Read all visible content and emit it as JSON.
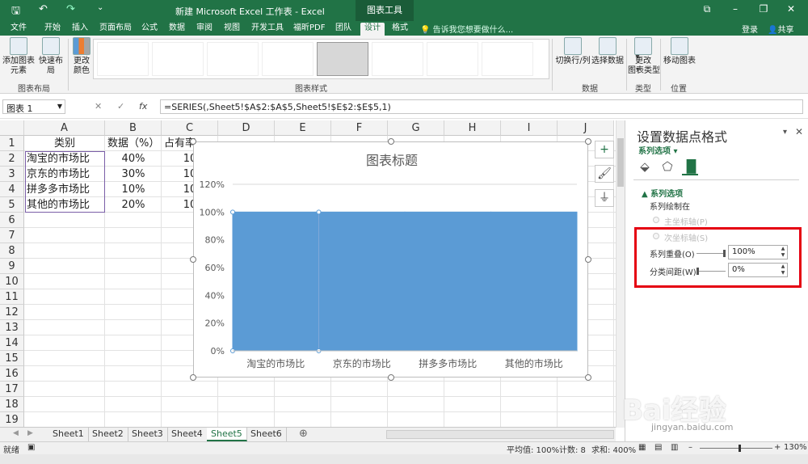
{
  "titlebar": {
    "title": "新建 Microsoft Excel 工作表 - Excel",
    "context_tab": "图表工具",
    "save": "🖫",
    "undo": "↶",
    "redo": "↷",
    "more": "⌄",
    "restore": "⧉",
    "minimize": "–",
    "maximize": "❐",
    "close": "✕"
  },
  "tabs": [
    "文件",
    "开始",
    "插入",
    "页面布局",
    "公式",
    "数据",
    "审阅",
    "视图",
    "开发工具",
    "福昕PDF",
    "团队",
    "设计",
    "格式"
  ],
  "tell_me": "告诉我您想要做什么...",
  "login": "登录",
  "share": "共享",
  "ribbon": {
    "add_element": "添加图表\n元素",
    "quick_layout": "快速布局",
    "change_color": "更改\n颜色",
    "group_layout": "图表布局",
    "group_styles": "图表样式",
    "switch_row_col": "切换行/列",
    "select_data": "选择数据",
    "group_data": "数据",
    "change_type": "更改\n图表类型",
    "group_type": "类型",
    "move_chart": "移动图表",
    "group_location": "位置"
  },
  "formula_bar": {
    "name_box": "图表 1",
    "formula": "=SERIES(,Sheet5!$A$2:$A$5,Sheet5!$E$2:$E$5,1)",
    "fx": "fx",
    "cancel": "✕",
    "enter": "✓"
  },
  "columns": [
    "A",
    "B",
    "C",
    "D",
    "E",
    "F",
    "G",
    "H",
    "I",
    "J"
  ],
  "rows": [
    "1",
    "2",
    "3",
    "4",
    "5",
    "6",
    "7",
    "8",
    "9",
    "10",
    "11",
    "12",
    "13",
    "14",
    "15",
    "16",
    "17",
    "18",
    "19"
  ],
  "cells": {
    "A1": "类别",
    "B1": "数据（%）",
    "C1": "占有率",
    "A2": "淘宝的市场比",
    "B2": "40%",
    "C2": "10",
    "A3": "京东的市场比",
    "B3": "30%",
    "C3": "10",
    "A4": "拼多多市场比",
    "B4": "10%",
    "C4": "10",
    "A5": "其他的市场比",
    "B5": "20%",
    "C5": "10"
  },
  "chart_data": {
    "type": "bar",
    "title": "图表标题",
    "categories": [
      "淘宝的市场比",
      "京东的市场比",
      "拼多多市场比",
      "其他的市场比"
    ],
    "values": [
      100,
      100,
      100,
      100
    ],
    "ylim": [
      0,
      120
    ],
    "yticks": [
      "0%",
      "20%",
      "40%",
      "60%",
      "80%",
      "100%",
      "120%"
    ],
    "color": "#5b9bd5",
    "gap_width": 0,
    "grid": true
  },
  "chart_side_buttons": {
    "add": "+",
    "style": "🖌",
    "filter": "⏚"
  },
  "sheets": [
    "Sheet1",
    "Sheet2",
    "Sheet3",
    "Sheet4",
    "Sheet5",
    "Sheet6"
  ],
  "active_sheet": "Sheet5",
  "add_sheet": "⊕",
  "status": {
    "ready": "就绪",
    "average": "平均值: 100%",
    "count": "计数: 8",
    "sum": "求和: 400%",
    "zoom": "130%"
  },
  "pane": {
    "title": "设置数据点格式",
    "subtitle": "系列选项",
    "section": "系列选项",
    "plot_on": "系列绘制在",
    "primary_axis": "主坐标轴(P)",
    "secondary_axis": "次坐标轴(S)",
    "overlap_label": "系列重叠(O)",
    "overlap_value": "100%",
    "gap_label": "分类间距(W)",
    "gap_value": "0%"
  },
  "watermark": "Bai经验",
  "watermark_url": "jingyan.baidu.com",
  "accent": "#217346"
}
